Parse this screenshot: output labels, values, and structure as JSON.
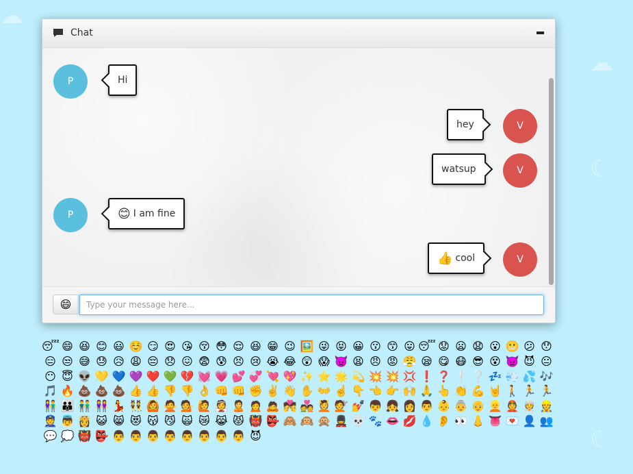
{
  "chat": {
    "title": "Chat",
    "input_placeholder": "Type your message here...",
    "emoji_button": "😄",
    "messages": [
      {
        "sender": "P",
        "side": "left",
        "text": "Hi",
        "emoji": ""
      },
      {
        "sender": "V",
        "side": "right",
        "text": "hey",
        "emoji": ""
      },
      {
        "sender": "V",
        "side": "right",
        "text": "watsup",
        "emoji": ""
      },
      {
        "sender": "P",
        "side": "left",
        "text": "I am fine",
        "emoji": "😊"
      },
      {
        "sender": "V",
        "side": "right",
        "text": "cool",
        "emoji": "👍"
      }
    ]
  },
  "colors": {
    "background": "#bfeefc",
    "avatar_p": "#5bc0de",
    "avatar_v": "#d9534f",
    "input_focus": "#66afe9"
  },
  "emojis": [
    "😴",
    "😄",
    "😆",
    "😊",
    "😃",
    "☺️",
    "😏",
    "😍",
    "😘",
    "😚",
    "😳",
    "😌",
    "😆",
    "😁",
    "😉",
    "🖼️",
    "😜",
    "😝",
    "😀",
    "😗",
    "😙",
    "😛",
    "😴",
    "😟",
    "😦",
    "😧",
    "😮",
    "😬",
    "😕",
    "😯",
    "😑",
    "😒",
    "😅",
    "😓",
    "😥",
    "😩",
    "😔",
    "😞",
    "😖",
    "😨",
    "😰",
    "😣",
    "😢",
    "😭",
    "😂",
    "😲",
    "😱",
    "👿",
    "😫",
    "😠",
    "😡",
    "😤",
    "😪",
    "😋",
    "😷",
    "😎",
    "😵",
    "👿",
    "😈",
    "😐",
    "😶",
    "😇",
    "👽",
    "💛",
    "💙",
    "💜",
    "❤️",
    "💚",
    "💔",
    "💓",
    "💗",
    "💕",
    "💞",
    "💘",
    "💖",
    "✨",
    "⭐",
    "🌟",
    "💫",
    "💥",
    "💥",
    "💢",
    "❗",
    "❓",
    "❕",
    "❔",
    "💤",
    "💨",
    "💦",
    "🎶",
    "🎵",
    "🔥",
    "💩",
    "💩",
    "💩",
    "👍",
    "👍",
    "👎",
    "👎",
    "👌",
    "👊",
    "👊",
    "✊",
    "✌️",
    "👋",
    "✋",
    "👐",
    "☝️",
    "👇",
    "👈",
    "👉",
    "🙌",
    "🙏",
    "👆",
    "👏",
    "💪",
    "🤘",
    "🚶",
    "🏃",
    "🏃",
    "👫",
    "👪",
    "👬",
    "👭",
    "💃",
    "👯",
    "🙆",
    "🙅",
    "💁",
    "🙋",
    "👰",
    "🙎",
    "🙍",
    "🙇",
    "💏",
    "💑",
    "💆",
    "💇",
    "💅",
    "👦",
    "👧",
    "👩",
    "👨",
    "👶",
    "👵",
    "👴",
    "👱",
    "👲",
    "👳",
    "👷",
    "👮",
    "👼",
    "👸",
    "😺",
    "😸",
    "😻",
    "😽",
    "😼",
    "🙀",
    "😿",
    "😹",
    "😾",
    "👹",
    "👺",
    "🙈",
    "🙉",
    "🙊",
    "💂",
    "💀",
    "🐾",
    "👄",
    "💋",
    "💧",
    "👂",
    "👀",
    "👃",
    "👅",
    "💌",
    "👤",
    "👥",
    "💬",
    "💭",
    "👹",
    "👺",
    "👨",
    "👨",
    "👨",
    "👨",
    "👨",
    "👨",
    "👨",
    "👨",
    "😈"
  ]
}
